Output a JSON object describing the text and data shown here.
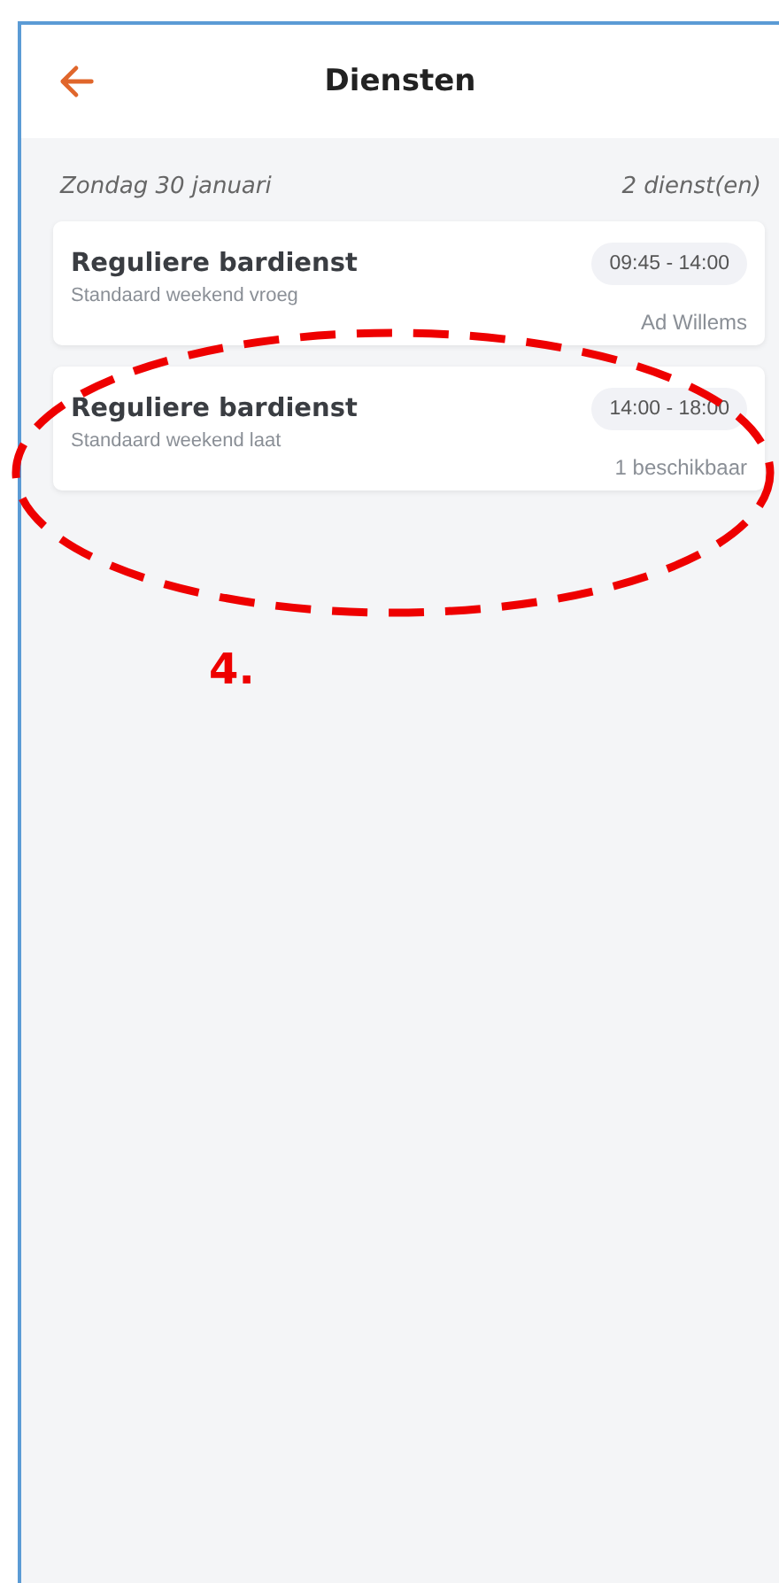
{
  "header": {
    "title": "Diensten"
  },
  "day": {
    "date": "Zondag 30 januari",
    "count": "2 dienst(en)"
  },
  "shifts": [
    {
      "title": "Reguliere bardienst",
      "subtitle": "Standaard weekend vroeg",
      "time": "09:45 - 14:00",
      "footer": "Ad Willems"
    },
    {
      "title": "Reguliere bardienst",
      "subtitle": "Standaard weekend laat",
      "time": "14:00 - 18:00",
      "footer": "1 beschikbaar"
    }
  ],
  "annotation": {
    "label": "4."
  }
}
